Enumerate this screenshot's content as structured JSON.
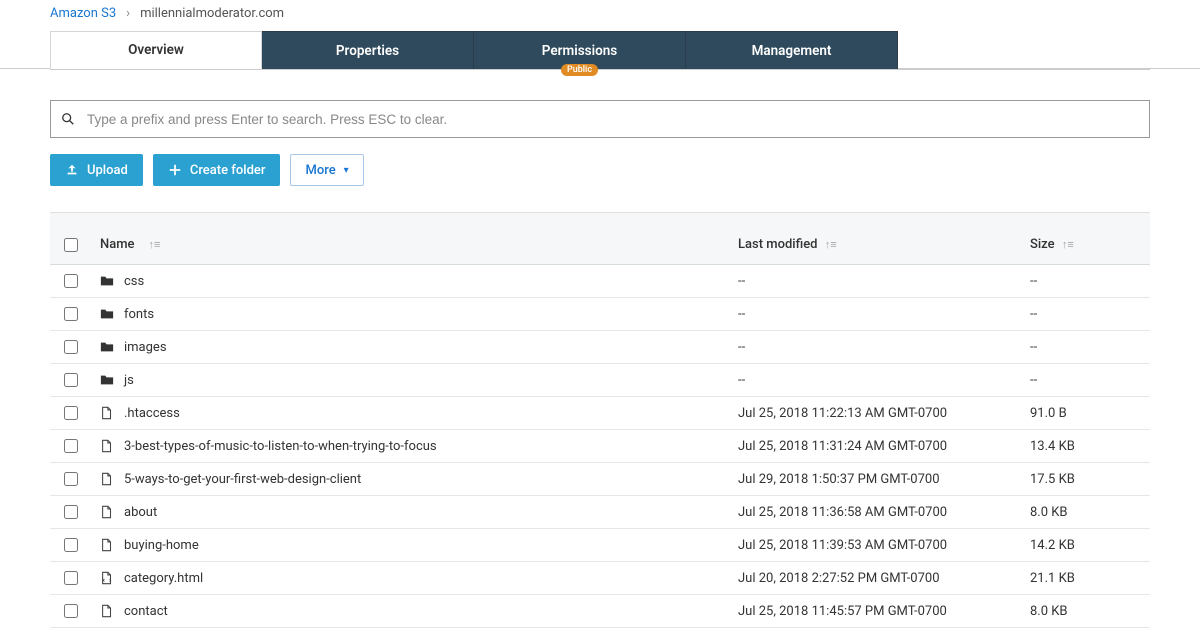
{
  "breadcrumb": {
    "root": "Amazon S3",
    "current": "millennialmoderator.com"
  },
  "tabs": [
    {
      "label": "Overview",
      "active": true
    },
    {
      "label": "Properties",
      "active": false
    },
    {
      "label": "Permissions",
      "active": false,
      "badge": "Public"
    },
    {
      "label": "Management",
      "active": false
    }
  ],
  "search": {
    "placeholder": "Type a prefix and press Enter to search. Press ESC to clear."
  },
  "toolbar": {
    "upload_label": "Upload",
    "create_folder_label": "Create folder",
    "more_label": "More"
  },
  "columns": {
    "name": "Name",
    "last_modified": "Last modified",
    "size": "Size"
  },
  "objects": [
    {
      "type": "folder",
      "name": "css",
      "modified": "--",
      "size": "--"
    },
    {
      "type": "folder",
      "name": "fonts",
      "modified": "--",
      "size": "--"
    },
    {
      "type": "folder",
      "name": "images",
      "modified": "--",
      "size": "--"
    },
    {
      "type": "folder",
      "name": "js",
      "modified": "--",
      "size": "--"
    },
    {
      "type": "file",
      "name": ".htaccess",
      "modified": "Jul 25, 2018 11:22:13 AM GMT-0700",
      "size": "91.0 B"
    },
    {
      "type": "file",
      "name": "3-best-types-of-music-to-listen-to-when-trying-to-focus",
      "modified": "Jul 25, 2018 11:31:24 AM GMT-0700",
      "size": "13.4 KB"
    },
    {
      "type": "file",
      "name": "5-ways-to-get-your-first-web-design-client",
      "modified": "Jul 29, 2018 1:50:37 PM GMT-0700",
      "size": "17.5 KB"
    },
    {
      "type": "file",
      "name": "about",
      "modified": "Jul 25, 2018 11:36:58 AM GMT-0700",
      "size": "8.0 KB"
    },
    {
      "type": "file",
      "name": "buying-home",
      "modified": "Jul 25, 2018 11:39:53 AM GMT-0700",
      "size": "14.2 KB"
    },
    {
      "type": "html",
      "name": "category.html",
      "modified": "Jul 20, 2018 2:27:52 PM GMT-0700",
      "size": "21.1 KB"
    },
    {
      "type": "file",
      "name": "contact",
      "modified": "Jul 25, 2018 11:45:57 PM GMT-0700",
      "size": "8.0 KB"
    }
  ]
}
